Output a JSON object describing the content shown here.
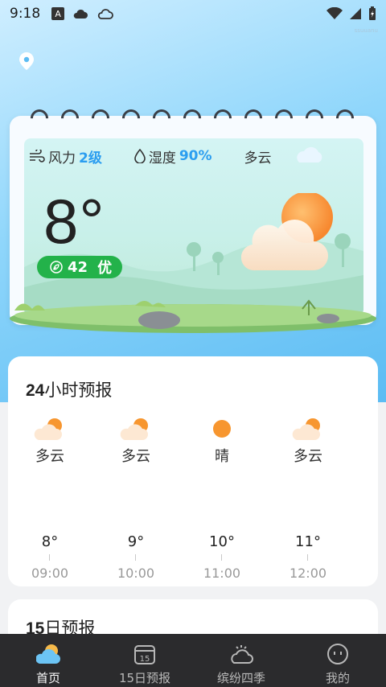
{
  "status_bar": {
    "time": "9:18",
    "watermark": "ssuuanu"
  },
  "hero": {
    "wind_label": "风力",
    "wind_value": "2级",
    "humidity_label": "湿度",
    "humidity_value": "90%",
    "condition": "多云",
    "temperature": "8°",
    "aqi_value": "42",
    "aqi_level": "优",
    "aqi_color": "#23b24a"
  },
  "hourly": {
    "title_bold": "24",
    "title_rest": "小时预报",
    "items": [
      {
        "cond": "多云",
        "icon": "partly-cloudy-icon",
        "temp": "8°",
        "time": "09:00"
      },
      {
        "cond": "多云",
        "icon": "partly-cloudy-icon",
        "temp": "9°",
        "time": "10:00"
      },
      {
        "cond": "晴",
        "icon": "sun-icon",
        "temp": "10°",
        "time": "11:00"
      },
      {
        "cond": "多云",
        "icon": "partly-cloudy-icon",
        "temp": "11°",
        "time": "12:00"
      }
    ]
  },
  "daily": {
    "title_bold": "15",
    "title_rest": "日预报"
  },
  "nav": {
    "items": [
      {
        "label": "首页",
        "icon": "weather-home-icon",
        "active": true
      },
      {
        "label": "15日预报",
        "icon": "calendar-icon",
        "active": false
      },
      {
        "label": "缤纷四季",
        "icon": "season-icon",
        "active": false
      },
      {
        "label": "我的",
        "icon": "profile-icon",
        "active": false
      }
    ]
  },
  "colors": {
    "accent": "#2c9ef0",
    "nav_bg": "#2b2b2d"
  }
}
